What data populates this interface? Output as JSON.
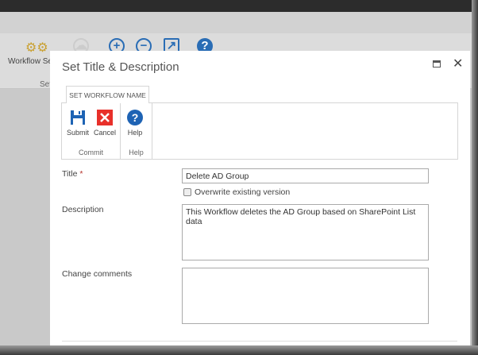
{
  "background": {
    "ribbon_button_label": "Workflow Sett",
    "ribbon_group_label": "Set",
    "ribbon_icons": [
      "gears-icon",
      "cloud-icon",
      "zoom-in-icon",
      "zoom-out-icon",
      "export-icon",
      "help-icon"
    ]
  },
  "dialog": {
    "title": "Set Title & Description",
    "tab_label": "SET WORKFLOW NAME",
    "groups": [
      {
        "label": "Commit",
        "buttons": [
          {
            "label": "Submit"
          },
          {
            "label": "Cancel"
          }
        ]
      },
      {
        "label": "Help",
        "buttons": [
          {
            "label": "Help"
          }
        ]
      }
    ],
    "form": {
      "title_label": "Title",
      "required_mark": "*",
      "title_value": "Delete AD Group",
      "overwrite_label": "Overwrite existing version",
      "overwrite_checked": false,
      "description_label": "Description",
      "description_value": "This Workflow deletes the AD Group based on SharePoint List data",
      "comments_label": "Change comments",
      "comments_value": ""
    }
  },
  "colors": {
    "accent": "#2a6db5",
    "cancel": "#e8302a",
    "gears": "#c9a030"
  }
}
